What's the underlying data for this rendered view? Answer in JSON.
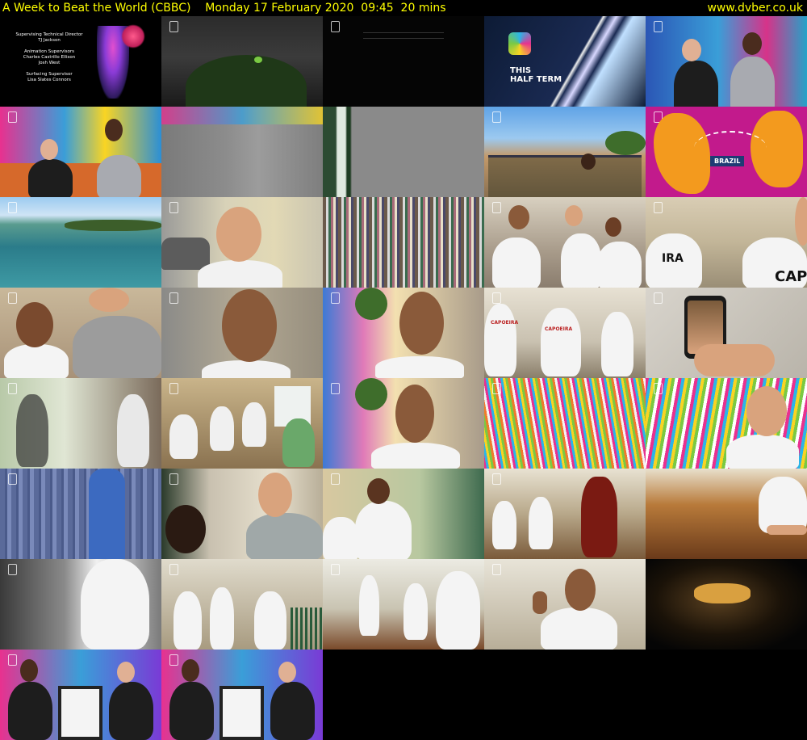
{
  "header": {
    "title": "A Week to Beat the World (CBBC)    Monday 17 February 2020  09:45  20 mins",
    "site": "www.dvber.co.uk"
  },
  "thumbnails": {
    "credits_text": "Supervising Technical Director\nTJ Jackson\n\nAnimation Supervisors\nCharles Castrillo Ellison\nJosh West\n\nSurfacing Supervisor\nLisa Slates Connors",
    "half_term_text": "THIS\nHALF TERM",
    "brazil_label": "BRAZIL",
    "capoeira_shirt": "CAPOEIRA",
    "capo_back": "CAPO",
    "ira_back": "IRA"
  },
  "colors": {
    "header_text": "#ffff00",
    "background": "#000000"
  }
}
